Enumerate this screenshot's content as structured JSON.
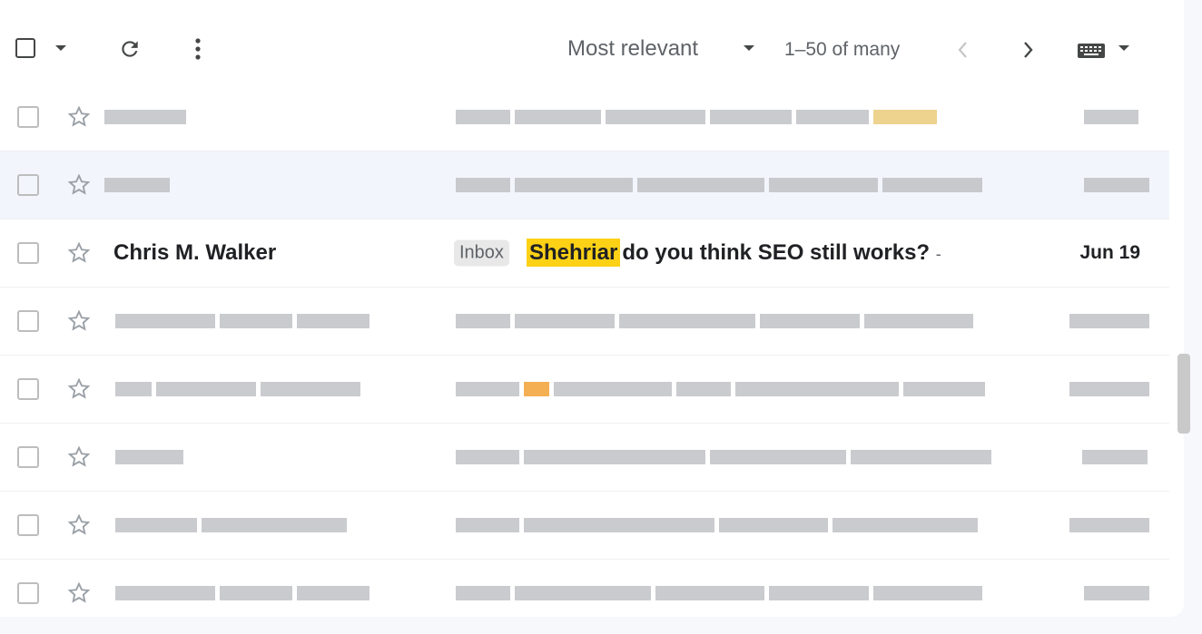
{
  "toolbar": {
    "select_all_caret": "select-menu",
    "sort": "Most relevant",
    "range": "1–50 of many",
    "icons": [
      "select-all-checkbox",
      "caret-down",
      "refresh-icon",
      "more-vertical-icon",
      "chevron-left-icon",
      "chevron-right-icon",
      "keyboard-icon"
    ]
  },
  "rows": [
    {
      "type": "redacted"
    },
    {
      "type": "redacted"
    },
    {
      "type": "visible",
      "sender": "Chris M. Walker",
      "label": "Inbox",
      "highlight": "Shehriar",
      "subject": "do you think SEO still works?",
      "separator": "-",
      "date": "Jun 19"
    },
    {
      "type": "redacted"
    },
    {
      "type": "redacted"
    },
    {
      "type": "redacted"
    },
    {
      "type": "redacted"
    },
    {
      "type": "redacted"
    }
  ],
  "colors": {
    "highlight": "#fcd116",
    "selected_row": "#f2f6fc",
    "chip_bg": "#e8e8e8"
  }
}
